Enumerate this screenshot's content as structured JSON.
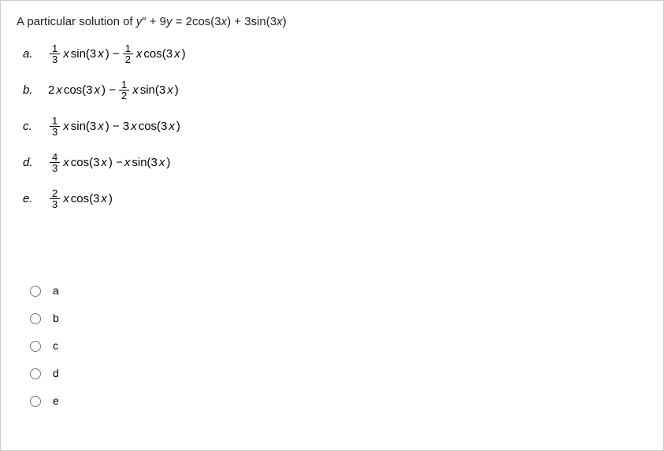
{
  "question": {
    "prefix": "A particular solution of  ",
    "equation_lhs_var": "y",
    "equation_lhs_prime": "″",
    "equation_mid": " + 9",
    "equation_lhs_var2": "y",
    "equation_eq": " = 2cos(3",
    "equation_var_x1": "x",
    "equation_part2": ") + 3sin(3",
    "equation_var_x2": "x",
    "equation_end": ")"
  },
  "options": [
    {
      "label": "a.",
      "frac1_num": "1",
      "frac1_den": "3",
      "part1_pre": "",
      "part1_x1": "x",
      "part1_func": "sin(3",
      "part1_x2": "x",
      "part1_close": ") − ",
      "frac2_num": "1",
      "frac2_den": "2",
      "part2_x1": "x",
      "part2_func": "cos(3",
      "part2_x2": "x",
      "part2_close": ")"
    },
    {
      "label": "b.",
      "part1_pre": "2",
      "part1_x1": "x",
      "part1_func": "cos(3",
      "part1_x2": "x",
      "part1_close": ") − ",
      "frac2_num": "1",
      "frac2_den": "2",
      "part2_x1": "x",
      "part2_func": "sin(3",
      "part2_x2": "x",
      "part2_close": ")"
    },
    {
      "label": "c.",
      "frac1_num": "1",
      "frac1_den": "3",
      "part1_x1": "x",
      "part1_func": "sin(3",
      "part1_x2": "x",
      "part1_close": ") − 3",
      "part2_x1": "x",
      "part2_func": "cos(3",
      "part2_x2": "x",
      "part2_close": ")"
    },
    {
      "label": "d.",
      "frac1_num": "4",
      "frac1_den": "3",
      "part1_x1": "x",
      "part1_func": "cos(3",
      "part1_x2": "x",
      "part1_close": ") − ",
      "part2_x1": "x",
      "part2_func": "sin(3",
      "part2_x2": "x",
      "part2_close": ")"
    },
    {
      "label": "e.",
      "frac1_num": "2",
      "frac1_den": "3",
      "part1_x1": "x",
      "part1_func": "cos(3",
      "part1_x2": "x",
      "part1_close": ")"
    }
  ],
  "radios": [
    {
      "label": "a"
    },
    {
      "label": "b"
    },
    {
      "label": "c"
    },
    {
      "label": "d"
    },
    {
      "label": "e"
    }
  ]
}
